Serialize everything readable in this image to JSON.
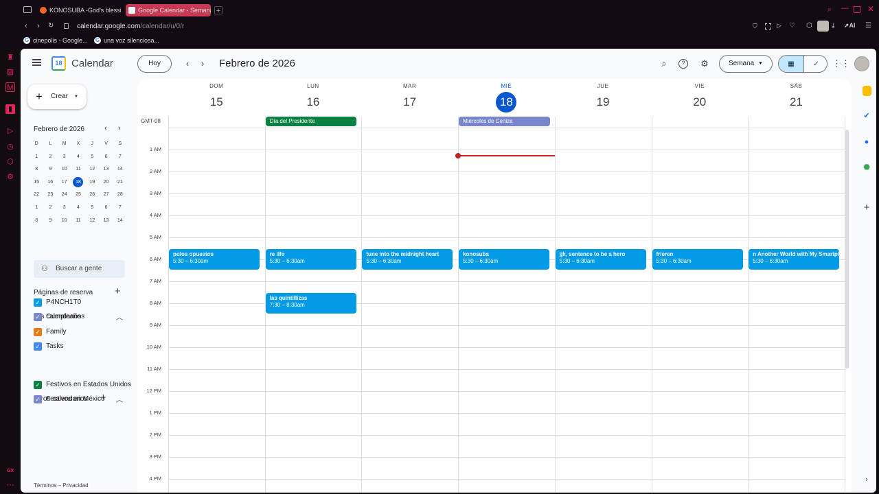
{
  "browser": {
    "tabs": [
      {
        "title": "KONOSUBA -God's blessin",
        "active": false
      },
      {
        "title": "Google Calendar - Semana",
        "active": true
      }
    ],
    "new_tab": "+",
    "url_host": "calendar.google.com",
    "url_path": "/calendar/u/0/r",
    "bookmarks": [
      "cinepolis - Google...",
      "una voz silenciosa..."
    ],
    "ai_label": "AI",
    "gx_label": "GX"
  },
  "header": {
    "app_name": "Calendar",
    "logo_number": "18",
    "today_button": "Hoy",
    "month_title": "Febrero de 2026",
    "view_select": "Semana"
  },
  "sidebar": {
    "create_label": "Crear",
    "mini_title": "Febrero de 2026",
    "weekday_initials": [
      "D",
      "L",
      "M",
      "X",
      "J",
      "V",
      "S"
    ],
    "weeks": [
      [
        "1",
        "2",
        "3",
        "4",
        "5",
        "6",
        "7"
      ],
      [
        "8",
        "9",
        "10",
        "11",
        "12",
        "13",
        "14"
      ],
      [
        "15",
        "16",
        "17",
        "18",
        "19",
        "20",
        "21"
      ],
      [
        "22",
        "23",
        "24",
        "25",
        "26",
        "27",
        "28"
      ],
      [
        "1",
        "2",
        "3",
        "4",
        "5",
        "6",
        "7"
      ],
      [
        "8",
        "9",
        "10",
        "11",
        "12",
        "13",
        "14"
      ]
    ],
    "search_people": "Buscar a gente",
    "booking_pages": "Páginas de reserva",
    "my_calendars_title": "Mis calendarios",
    "my_calendars": [
      {
        "name": "P4NCH1T0",
        "color": "#039be5"
      },
      {
        "name": "Cumpleaños",
        "color": "#7986cb"
      },
      {
        "name": "Family",
        "color": "#e67c17"
      },
      {
        "name": "Tasks",
        "color": "#4285f4"
      }
    ],
    "other_calendars_title": "Otros calendarios",
    "other_calendars": [
      {
        "name": "Festivos en Estados Unidos",
        "color": "#0b8043"
      },
      {
        "name": "Festivos en México",
        "color": "#7986cb"
      }
    ],
    "footer": "Términos – Privacidad"
  },
  "week": {
    "timezone": "GMT-08",
    "days": [
      {
        "name": "DOM",
        "date": "15"
      },
      {
        "name": "LUN",
        "date": "16"
      },
      {
        "name": "MAR",
        "date": "17"
      },
      {
        "name": "MIÉ",
        "date": "18",
        "today": true
      },
      {
        "name": "JUE",
        "date": "19"
      },
      {
        "name": "VIE",
        "date": "20"
      },
      {
        "name": "SÁB",
        "date": "21"
      }
    ],
    "hours": [
      "1 AM",
      "2 AM",
      "3 AM",
      "4 AM",
      "5 AM",
      "6 AM",
      "7 AM",
      "8 AM",
      "9 AM",
      "10 AM",
      "11 AM",
      "12 PM",
      "1 PM",
      "2 PM",
      "3 PM",
      "4 PM"
    ],
    "all_day_events": [
      {
        "title": "Día del Presidente",
        "day": 1,
        "color": "#0b8043"
      },
      {
        "title": "Miércoles de Ceniza",
        "day": 3,
        "color": "#7986cb"
      }
    ],
    "events": [
      {
        "title": "polos opuestos",
        "time": "5:30 – 6:30am",
        "day": 0
      },
      {
        "title": "re life",
        "time": "5:30 – 6:30am",
        "day": 1
      },
      {
        "title": "tune into the midnight heart",
        "time": "5:30 – 6:30am",
        "day": 2
      },
      {
        "title": "konosuba",
        "time": "5:30 – 6:30am",
        "day": 3
      },
      {
        "title": "jjk, sentence to be a hero",
        "time": "5:30 – 6:30am",
        "day": 4
      },
      {
        "title": "frieren",
        "time": "5:30 – 6:30am",
        "day": 5
      },
      {
        "title": "n Another World with My Smartph",
        "time": "5:30 – 6:30am",
        "day": 6
      },
      {
        "title": "las quintillizas",
        "time": "7:30 – 8:30am",
        "day": 1
      }
    ],
    "event_color": "#039be5",
    "now_indicator_color": "#c5221f"
  }
}
